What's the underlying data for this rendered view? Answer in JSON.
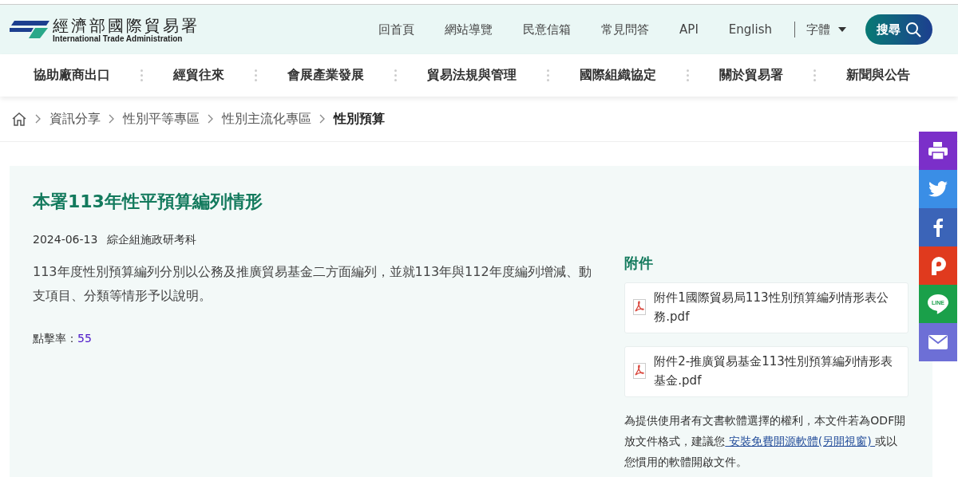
{
  "header": {
    "logo_title": "經濟部國際貿易署",
    "logo_subtitle": "International Trade Administration",
    "links": [
      "回首頁",
      "網站導覽",
      "民意信箱",
      "常見問答",
      "API",
      "English"
    ],
    "font_menu": "字體",
    "search_button": "搜尋"
  },
  "nav": [
    "協助廠商出口",
    "經貿往來",
    "會展產業發展",
    "貿易法規與管理",
    "國際組織協定",
    "關於貿易署",
    "新聞與公告"
  ],
  "breadcrumb": [
    {
      "label": "資訊分享",
      "selected": false
    },
    {
      "label": "性別平等專區",
      "selected": false
    },
    {
      "label": "性別主流化專區",
      "selected": false
    },
    {
      "label": "性別預算",
      "selected": true
    }
  ],
  "article": {
    "title": "本署113年性平預算編列情形",
    "date": "2024-06-13",
    "unit": "綜企組施政研考科",
    "body": "113年度性別預算編列分別以公務及推廣貿易基金二方面編列，並就113年與112年度編列增減、動支項目、分類等情形予以說明。",
    "hits_label": "點擊率：",
    "hits": "55"
  },
  "attachments": {
    "heading": "附件",
    "files": [
      "附件1國際貿易局113性別預算編列情形表公務.pdf",
      "附件2-推廣貿易基金113性別預算編列情形表基金.pdf"
    ],
    "note_before": "為提供使用者有文書軟體選擇的權利，本文件若為ODF開放文件格式，建議您",
    "note_link": " 安裝免費開源軟體(另開視窗) ",
    "note_after": "或以您慣用的軟體開啟文件。"
  },
  "share": [
    {
      "kind": "print",
      "color": "#7b2fc9"
    },
    {
      "kind": "twitter",
      "color": "#3a8ee6"
    },
    {
      "kind": "facebook",
      "color": "#3b64b8"
    },
    {
      "kind": "plurk",
      "color": "#e03a1e"
    },
    {
      "kind": "line",
      "color": "#1aa04a",
      "label": "LINE"
    },
    {
      "kind": "mail",
      "color": "#6d6fd6"
    }
  ]
}
